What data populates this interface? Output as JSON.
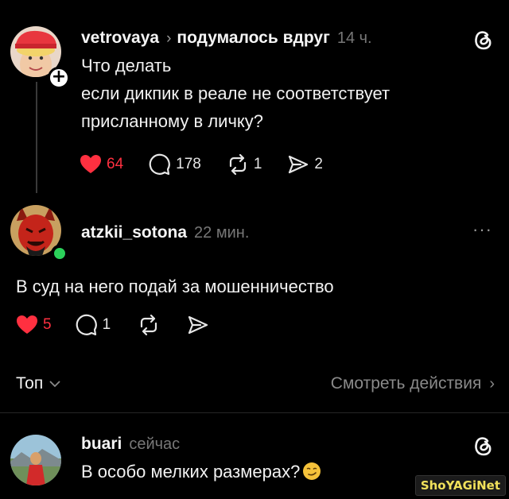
{
  "post1": {
    "username": "vetrovaya",
    "community": "подумалось вдруг",
    "time": "14 ч.",
    "text": [
      "Что делать",
      "если дикпик в реале не соответствует",
      "присланному в личку?"
    ],
    "likes": "64",
    "replies": "178",
    "reposts": "1",
    "shares": "2",
    "avatar_icon": "user-avatar-red-hat",
    "follow_icon": "plus-icon"
  },
  "post2": {
    "username": "atzkii_sotona",
    "time": "22 мин.",
    "text": "В суд на него подай за мошенничество",
    "likes": "5",
    "replies": "1",
    "more_icon": "more-dots-icon",
    "status": "online"
  },
  "sort": {
    "label": "Топ",
    "activity_link": "Смотреть действия"
  },
  "post3": {
    "username": "buari",
    "time": "сейчас",
    "text": "В особо мелких размерах?",
    "emoji": "smirking-face"
  },
  "watermark": {
    "text": "ShoYAGiNet"
  },
  "colors": {
    "background": "#000000",
    "like_red": "#ff3040",
    "muted": "#777777",
    "online": "#2bd15a"
  }
}
